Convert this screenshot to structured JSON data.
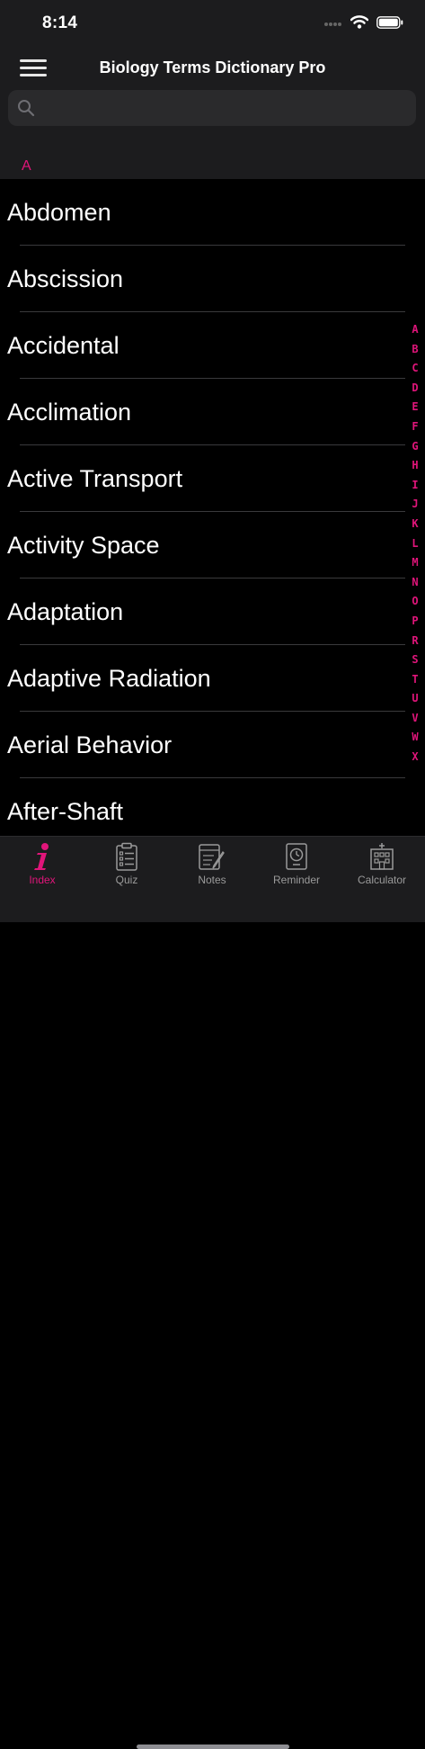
{
  "status": {
    "time": "8:14"
  },
  "nav": {
    "title": "Biology Terms Dictionary Pro"
  },
  "search": {
    "placeholder": ""
  },
  "section": {
    "letter": "A"
  },
  "terms": [
    "Abdomen",
    "Abscission",
    "Accidental",
    "Acclimation",
    "Active Transport",
    "Activity Space",
    "Adaptation",
    "Adaptive Radiation",
    "Aerial Behavior",
    "After-Shaft"
  ],
  "alphabet": [
    "A",
    "B",
    "C",
    "D",
    "E",
    "F",
    "G",
    "H",
    "I",
    "J",
    "K",
    "L",
    "M",
    "N",
    "O",
    "P",
    "R",
    "S",
    "T",
    "U",
    "V",
    "W",
    "X"
  ],
  "tabs": [
    {
      "label": "Index",
      "icon": "info-icon",
      "active": true
    },
    {
      "label": "Quiz",
      "icon": "clipboard-icon",
      "active": false
    },
    {
      "label": "Notes",
      "icon": "notes-icon",
      "active": false
    },
    {
      "label": "Reminder",
      "icon": "clock-icon",
      "active": false
    },
    {
      "label": "Calculator",
      "icon": "building-icon",
      "active": false
    }
  ],
  "colors": {
    "accent": "#e0157a",
    "background": "#000000",
    "bar": "#1c1c1e"
  }
}
